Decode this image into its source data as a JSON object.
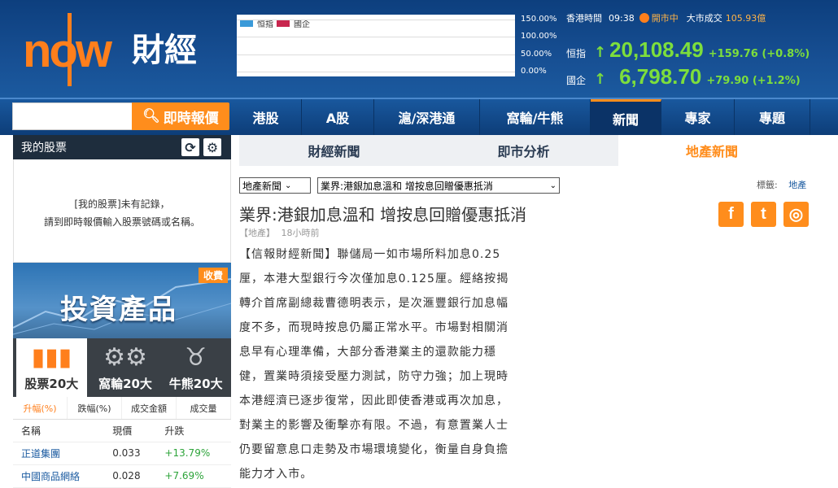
{
  "header": {
    "logo_now": "now",
    "logo_cjk": "財經",
    "mini_chart": {
      "legend": [
        {
          "label": "恒指",
          "color": "#3a9ad9"
        },
        {
          "label": "國企",
          "color": "#c8264e"
        }
      ],
      "ticks": [
        "150.00%",
        "100.00%",
        "50.00%",
        "0.00%"
      ]
    },
    "market": {
      "time_label": "香港時間",
      "time": "09:38",
      "status": "開市中",
      "turnover_label": "大市成交",
      "turnover": "105.93億",
      "indices": [
        {
          "name": "恒指",
          "value": "20,108.49",
          "change": "+159.76 (+0.8%)"
        },
        {
          "name": "國企",
          "value": "6,798.70",
          "change": "+79.90 (+1.2%)"
        }
      ]
    }
  },
  "nav": {
    "search_placeholder": "",
    "search_button": "即時報價",
    "items": [
      "港股",
      "A股",
      "滬/深港通",
      "窩輪/牛熊",
      "新聞",
      "專家",
      "專題"
    ],
    "active": "新聞"
  },
  "left": {
    "mystock_title": "我的股票",
    "mystock_msg_line1": "[我的股票]未有記錄，",
    "mystock_msg_line2": "請到即時報價輸入股票號碼或名稱。",
    "banner_title": "投資產品",
    "banner_tag": "收費",
    "top20": [
      "股票20大",
      "窩輪20大",
      "牛熊20大"
    ],
    "rank_tabs": [
      "升幅(%)",
      "跌幅(%)",
      "成交金額",
      "成交量"
    ],
    "table_headers": [
      "名稱",
      "現價",
      "升跌"
    ],
    "rows": [
      {
        "name": "正道集團",
        "price": "0.033",
        "change": "+13.79%"
      },
      {
        "name": "中國商品網絡",
        "price": "0.028",
        "change": "+7.69%"
      }
    ]
  },
  "article": {
    "tabs": [
      "財經新聞",
      "即市分析"
    ],
    "active_tab": "地產新聞",
    "select_category": "地產新聞",
    "select_article": "業界:港銀加息溫和 增按息回贈優惠抵消",
    "tags_label": "標籤:",
    "tag": "地產",
    "title": "業界:港銀加息溫和 增按息回贈優惠抵消",
    "category": "【地產】",
    "time": "18小時前",
    "body": [
      "【信報財經新聞】聯儲局一如市場所料加息0.25",
      "厘，本港大型銀行今次僅加息0.125厘。經絡按揭",
      "轉介首席副總裁曹德明表示，是次滙豐銀行加息幅",
      "度不多，而現時按息仍屬正常水平。市場對相關消",
      "息早有心理準備，大部分香港業主的還款能力穩",
      "健，置業時須接受壓力測試，防守力強；加上現時",
      "本港經濟已逐步復常，因此即使香港或再次加息，",
      "對業主的影響及衝擊亦有限。不過，有意置業人士",
      "仍要留意息口走勢及市場環境變化，衡量自身負擔",
      "能力才入市。"
    ],
    "social": [
      "facebook-icon",
      "twitter-icon",
      "weibo-icon"
    ]
  }
}
